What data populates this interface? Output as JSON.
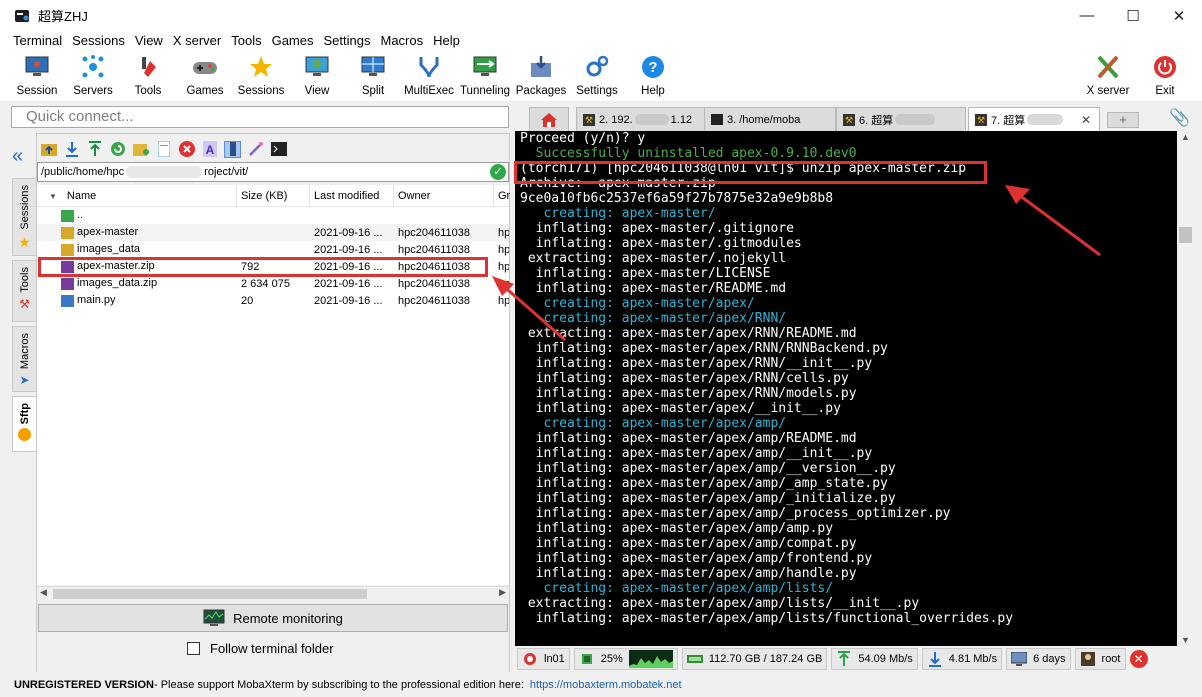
{
  "window": {
    "title": "超算ZHJ"
  },
  "menu": [
    "Terminal",
    "Sessions",
    "View",
    "X server",
    "Tools",
    "Games",
    "Settings",
    "Macros",
    "Help"
  ],
  "toolbar": {
    "session": "Session",
    "servers": "Servers",
    "tools": "Tools",
    "games": "Games",
    "sessions": "Sessions",
    "view": "View",
    "split": "Split",
    "multiexec": "MultiExec",
    "tunneling": "Tunneling",
    "packages": "Packages",
    "settings": "Settings",
    "help": "Help",
    "xserver": "X server",
    "exit": "Exit"
  },
  "quick_connect": {
    "placeholder": "Quick connect..."
  },
  "side_tabs": [
    "Sessions",
    "Tools",
    "Macros",
    "Sftp"
  ],
  "sftp": {
    "path": "/public/home/hpc",
    "path_tail": "roject/vit/",
    "columns": [
      "Name",
      "Size (KB)",
      "Last modified",
      "Owner",
      "Gr"
    ],
    "rows": [
      {
        "name": "..",
        "size": "",
        "modified": "",
        "owner": "",
        "group": ""
      },
      {
        "name": "apex-master",
        "size": "",
        "modified": "2021-09-16 ...",
        "owner": "hpc204611038",
        "group": "hp"
      },
      {
        "name": "images_data",
        "size": "",
        "modified": "2021-09-16 ...",
        "owner": "hpc204611038",
        "group": "hp"
      },
      {
        "name": "apex-master.zip",
        "size": "792",
        "modified": "2021-09-16 ...",
        "owner": "hpc204611038",
        "group": "hp"
      },
      {
        "name": "images_data.zip",
        "size": "2 634 075",
        "modified": "2021-09-16 ...",
        "owner": "hpc204611038",
        "group": "hp"
      },
      {
        "name": "main.py",
        "size": "20",
        "modified": "2021-09-16 ...",
        "owner": "hpc204611038",
        "group": "hp"
      }
    ],
    "remote_monitoring": "Remote monitoring",
    "follow_folder": "Follow terminal folder"
  },
  "tabs": [
    "2. 192.",
    "1.12",
    "3. /home/moba",
    "6. 超算",
    "7. 超算"
  ],
  "terminal": {
    "lines": [
      "Proceed (y/n)? y",
      "  Successfully uninstalled apex-0.9.10.dev0",
      "(torch171) [hpc204611038@ln01 vit]$ unzip apex-master.zip",
      "Archive:  apex-master.zip",
      "9ce0a10fb6c2537ef6a59f27b7875e32a9e9b8b8",
      "   creating: apex-master/",
      "  inflating: apex-master/.gitignore",
      "  inflating: apex-master/.gitmodules",
      " extracting: apex-master/.nojekyll",
      "  inflating: apex-master/LICENSE",
      "  inflating: apex-master/README.md",
      "   creating: apex-master/apex/",
      "   creating: apex-master/apex/RNN/",
      " extracting: apex-master/apex/RNN/README.md",
      "  inflating: apex-master/apex/RNN/RNNBackend.py",
      "  inflating: apex-master/apex/RNN/__init__.py",
      "  inflating: apex-master/apex/RNN/cells.py",
      "  inflating: apex-master/apex/RNN/models.py",
      "  inflating: apex-master/apex/__init__.py",
      "   creating: apex-master/apex/amp/",
      "  inflating: apex-master/apex/amp/README.md",
      "  inflating: apex-master/apex/amp/__init__.py",
      "  inflating: apex-master/apex/amp/__version__.py",
      "  inflating: apex-master/apex/amp/_amp_state.py",
      "  inflating: apex-master/apex/amp/_initialize.py",
      "  inflating: apex-master/apex/amp/_process_optimizer.py",
      "  inflating: apex-master/apex/amp/amp.py",
      "  inflating: apex-master/apex/amp/compat.py",
      "  inflating: apex-master/apex/amp/frontend.py",
      "  inflating: apex-master/apex/amp/handle.py",
      "   creating: apex-master/apex/amp/lists/",
      " extracting: apex-master/apex/amp/lists/__init__.py",
      "  inflating: apex-master/apex/amp/lists/functional_overrides.py"
    ]
  },
  "status": {
    "host": "ln01",
    "cpu": "25%",
    "disk": "112.70 GB / 187.24 GB",
    "upload": "54.09 Mb/s",
    "download": "4.81 Mb/s",
    "uptime": "6 days",
    "user": "root"
  },
  "footer": {
    "unregistered": "UNREGISTERED VERSION",
    "message": "  -  Please support MobaXterm by subscribing to the professional edition here:",
    "link": "https://mobaxterm.mobatek.net"
  },
  "colors": {
    "accent_red": "#e03131",
    "terminal_bg": "#000000",
    "creating_color": "#2fb3d3",
    "success_green": "#4cae4c"
  }
}
